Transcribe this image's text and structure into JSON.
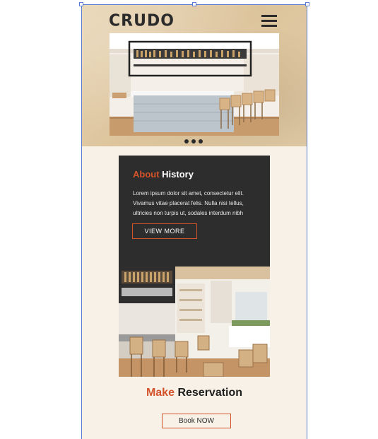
{
  "brand": {
    "logo_text": "CRUDO"
  },
  "header": {
    "menu_icon": "hamburger-menu-icon"
  },
  "hero": {
    "slides_total": 3,
    "active_slide": 1
  },
  "about": {
    "title_accent": "About",
    "title_main": "History",
    "body": "Lorem ipsum dolor sit amet, consectetur  elit. Vivamus vitae placerat felis. Nulla nisi tellus, ultricies non turpis ut, sodales interdum nibh",
    "button_label": "VIEW MORE"
  },
  "reservation": {
    "title_accent": "Make",
    "title_main": "Reservation",
    "button_label": "Book NOW"
  },
  "colors": {
    "accent": "#d4532a",
    "dark_card": "#2d2d2d",
    "page_bg": "#f7f1e7",
    "header_bg": "#dcc39b"
  }
}
